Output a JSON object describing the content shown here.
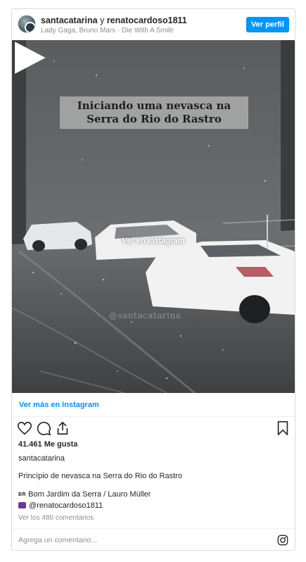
{
  "header": {
    "owner_username": "santacatarina",
    "connector": " y ",
    "coauthor_username": "renatocardoso1811",
    "audio": "Lady Gaga, Bruno Mars · Die With A Smile",
    "profile_button": "Ver perfil"
  },
  "media": {
    "overlay_line1": "Iniciando uma nevasca na",
    "overlay_line2": "Serra do Rio do Rastro",
    "watermark": "@santacatarina",
    "play_label": "Ver en Instagram",
    "play_icon": "play-icon"
  },
  "view_more": "Ver más en Instagram",
  "actions": {
    "icons": [
      "heart-icon",
      "comment-icon",
      "share-icon",
      "bookmark-icon"
    ]
  },
  "likes": "41.461 Me gusta",
  "owner_line": "santacatarina",
  "caption": "Princípio de nevasca na Serra do Rio do Rastro",
  "location": {
    "flag": "BR",
    "text": "Bom Jardim da Serra / Lauro Müller"
  },
  "mention": "@renatocardoso1811",
  "comments_link": "Ver los 480 comentarios",
  "add_comment_placeholder": "Agrega un comentario...",
  "colors": {
    "accent": "#0095f6",
    "text": "#262626",
    "muted": "#8e8e8e",
    "border": "#dbdbdb"
  }
}
